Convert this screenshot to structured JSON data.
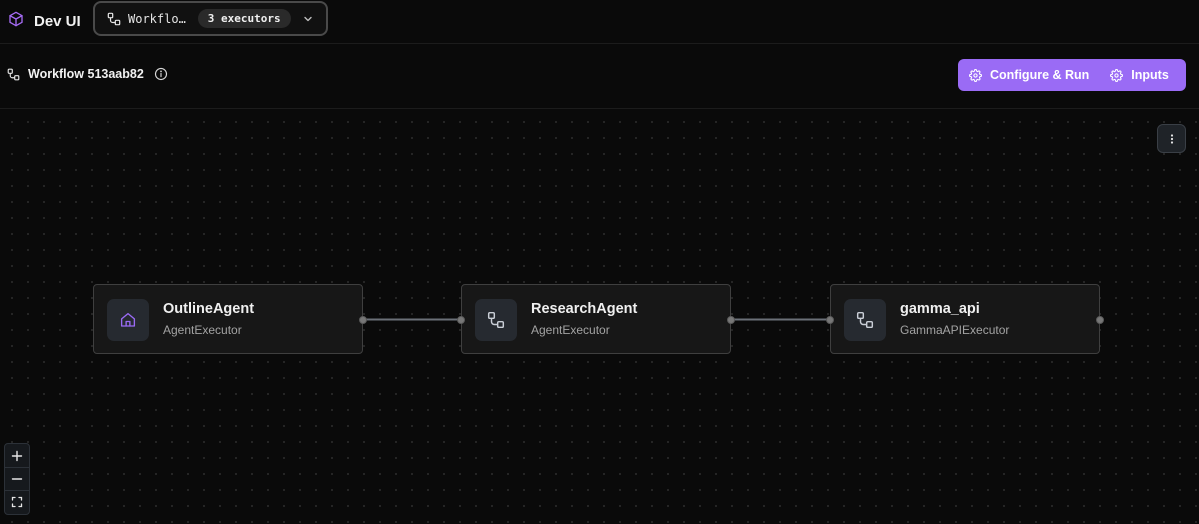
{
  "app": {
    "title": "Dev UI",
    "logo_icon": "cube-logo-icon",
    "accent_color": "#9a6bf5"
  },
  "workflow_selector": {
    "icon": "workflow-icon",
    "value": "Workflo…",
    "badge": "3 executors",
    "chevron_icon": "chevron-down-icon"
  },
  "header": {
    "workflow_name": "Workflow 513aab82",
    "info_icon": "info-icon"
  },
  "actions": {
    "configure_run": {
      "label": "Configure & Run",
      "icon": "gear-icon"
    },
    "inputs": {
      "label": "Inputs",
      "icon": "gear-icon"
    }
  },
  "canvas_menu": {
    "icon": "more-vertical-icon"
  },
  "nodes": [
    {
      "title": "OutlineAgent",
      "subtitle": "AgentExecutor",
      "icon": "home-icon",
      "icon_color": "#9a6bf5"
    },
    {
      "title": "ResearchAgent",
      "subtitle": "AgentExecutor",
      "icon": "workflow-icon",
      "icon_color": "#c9ced6"
    },
    {
      "title": "gamma_api",
      "subtitle": "GammaAPIExecutor",
      "icon": "workflow-icon",
      "icon_color": "#c9ced6"
    }
  ],
  "zoom_controls": {
    "zoom_in_icon": "plus-icon",
    "zoom_out_icon": "minus-icon",
    "fit_view_icon": "fit-view-icon"
  }
}
